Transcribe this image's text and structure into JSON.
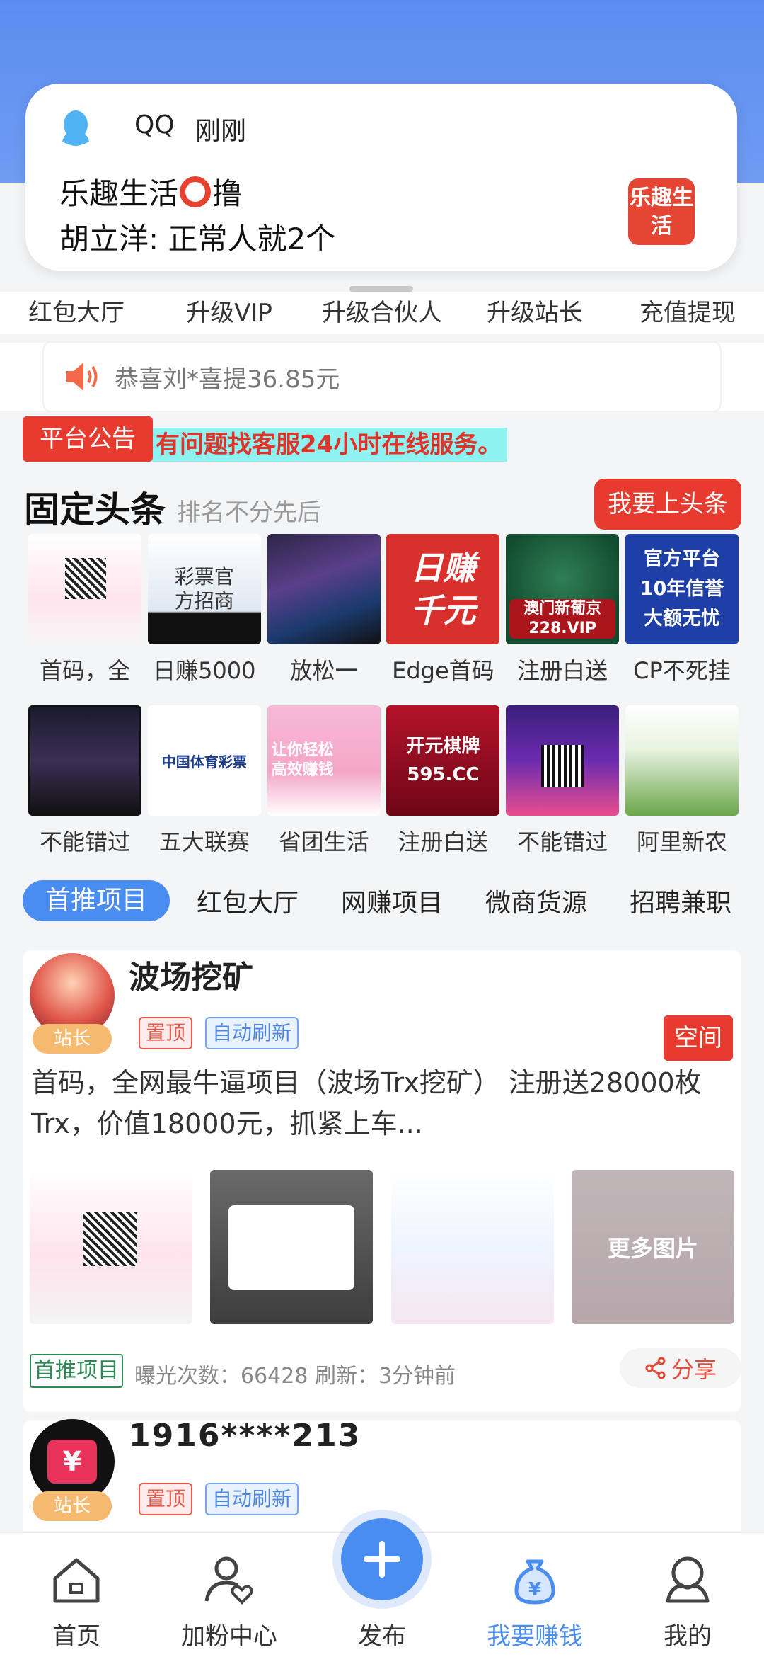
{
  "notification": {
    "app": "QQ",
    "time": "刚刚",
    "title_left": "乐趣生活",
    "title_right": "撸",
    "body": "胡立洋: 正常人就2个",
    "thumb_text": "乐趣生活"
  },
  "quick_menu": [
    "红包大厅",
    "升级VIP",
    "升级合伙人",
    "升级站长",
    "充值提现"
  ],
  "ticker": {
    "text": "恭喜刘*喜提36.85元"
  },
  "announcement": {
    "tag": "平台公告",
    "text": "有问题找客服24小时在线服务。"
  },
  "fixed_headlines": {
    "title": "固定头条",
    "subtitle": "排名不分先后",
    "button": "我要上头条",
    "row1": [
      {
        "label": "首码，全",
        "thumb_text": ""
      },
      {
        "label": "日赚5000",
        "thumb_text": "彩票官方招商"
      },
      {
        "label": "放松一",
        "thumb_text": ""
      },
      {
        "label": "Edge首码",
        "thumb_text": "日赚千元"
      },
      {
        "label": "注册白送",
        "thumb_text": "澳门新葡京 228.VIP"
      },
      {
        "label": "CP不死挂",
        "thumb_text": "官方平台 10年信誉 大额无忧"
      }
    ],
    "row2": [
      {
        "label": "不能错过",
        "thumb_text": ""
      },
      {
        "label": "五大联赛",
        "thumb_text": "中国体育彩票"
      },
      {
        "label": "省团生活",
        "thumb_text": "让你轻松 高效赚钱"
      },
      {
        "label": "注册白送",
        "thumb_text": "开元棋牌 595.CC"
      },
      {
        "label": "不能错过",
        "thumb_text": ""
      },
      {
        "label": "阿里新农",
        "thumb_text": ""
      }
    ]
  },
  "categories": [
    "首推项目",
    "红包大厅",
    "网赚项目",
    "微商货源",
    "招聘兼职"
  ],
  "posts": [
    {
      "title": "波场挖矿",
      "badge": "站长",
      "tags": [
        "置顶",
        "自动刷新"
      ],
      "space_button": "空间",
      "desc": "首码，全网最牛逼项目（波场Trx挖矿） 注册送28000枚Trx，价值18000元，抓紧上车...",
      "more_images": "更多图片",
      "category_tag": "首推项目",
      "stats": "曝光次数：66428  刷新：3分钟前",
      "share": "分享"
    },
    {
      "title": "1916****213",
      "badge": "站长",
      "tags": [
        "置顶",
        "自动刷新"
      ]
    }
  ],
  "nav": [
    {
      "label": "首页",
      "icon": "home-icon"
    },
    {
      "label": "加粉中心",
      "icon": "user-heart-icon"
    },
    {
      "label": "发布",
      "icon": "plus-icon"
    },
    {
      "label": "我要赚钱",
      "icon": "money-bag-icon"
    },
    {
      "label": "我的",
      "icon": "profile-icon"
    }
  ],
  "colors": {
    "primary": "#4a8df1",
    "accent_red": "#e63b2e",
    "header": "#5b8df0"
  }
}
